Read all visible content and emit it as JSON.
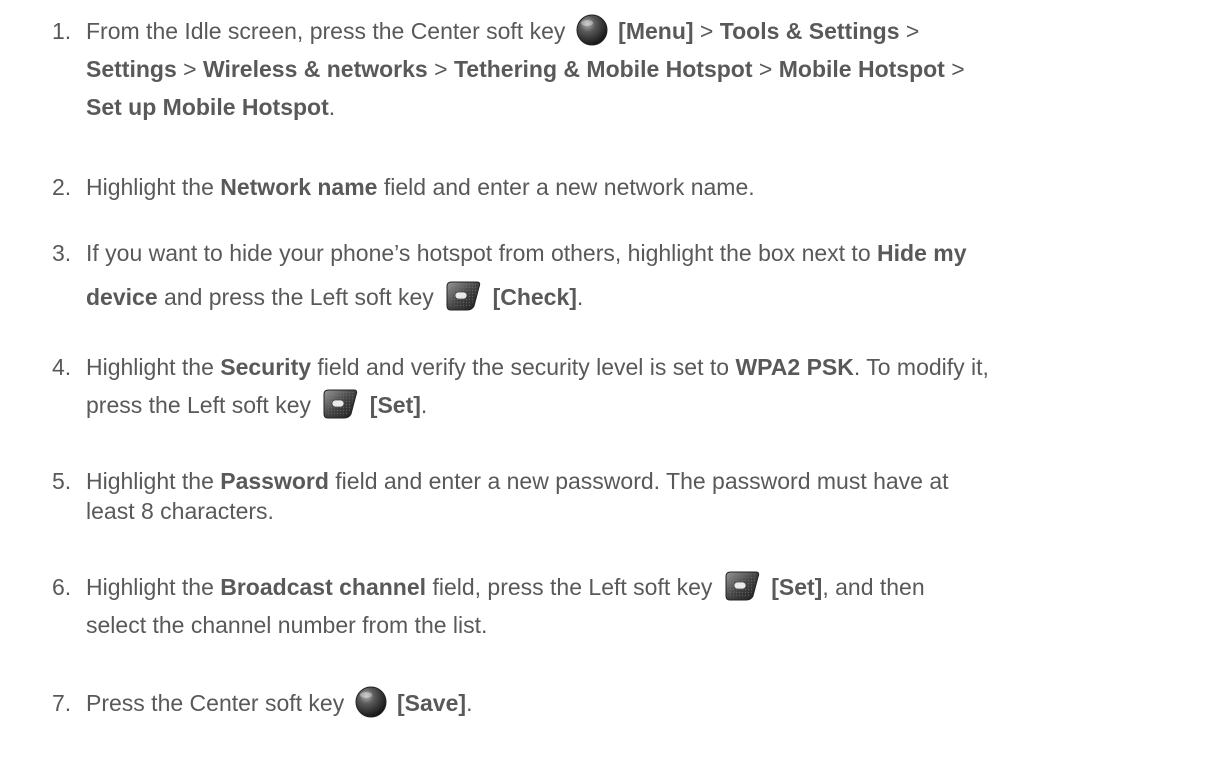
{
  "steps": [
    {
      "number": "1.",
      "parts": {
        "a": "From the Idle screen, press the Center soft key",
        "b": "[Menu]",
        "c": ">",
        "d": "Tools & Settings",
        "e": ">",
        "f": "Settings",
        "g": ">",
        "h": "Wireless & networks",
        "i": ">",
        "j": "Tethering & Mobile Hotspot",
        "k": ">",
        "l": "Mobile Hotspot",
        "m": ">",
        "n": "Set up Mobile Hotspot",
        "o": "."
      },
      "key_icon": "center-soft-key-icon"
    },
    {
      "number": "2.",
      "parts": {
        "a": "Highlight the",
        "b": "Network name",
        "c": "field and enter a new network name."
      }
    },
    {
      "number": "3.",
      "parts": {
        "a": "If you want to hide your phone’s hotspot from others, highlight the box next to",
        "b": "Hide my",
        "c": "device",
        "d": "and press the Left soft key",
        "e": "[Check]",
        "f": "."
      },
      "key_icon": "left-soft-key-icon"
    },
    {
      "number": "4.",
      "parts": {
        "a": "Highlight the",
        "b": "Security",
        "c": "field and verify the security level is set to",
        "d": "WPA2 PSK",
        "e": ". To modify it,",
        "f": "press the Left soft key",
        "g": "[Set]",
        "h": "."
      },
      "key_icon": "left-soft-key-icon"
    },
    {
      "number": "5.",
      "parts": {
        "a": "Highlight the",
        "b": "Password",
        "c": "field and enter a new password. The password must have at",
        "d": "least 8 characters."
      }
    },
    {
      "number": "6.",
      "parts": {
        "a": "Highlight the",
        "b": "Broadcast channel",
        "c": "field, press the Left soft key",
        "d": "[Set]",
        "e": ", and then",
        "f": "select the channel number from the list."
      },
      "key_icon": "left-soft-key-icon"
    },
    {
      "number": "7.",
      "parts": {
        "a": "Press the Center soft key",
        "b": "[Save]",
        "c": "."
      },
      "key_icon": "center-soft-key-icon"
    }
  ],
  "colors": {
    "body_text": "#595959",
    "heading_accent": "#e0204a",
    "key_dark": "#3a3a3a"
  }
}
